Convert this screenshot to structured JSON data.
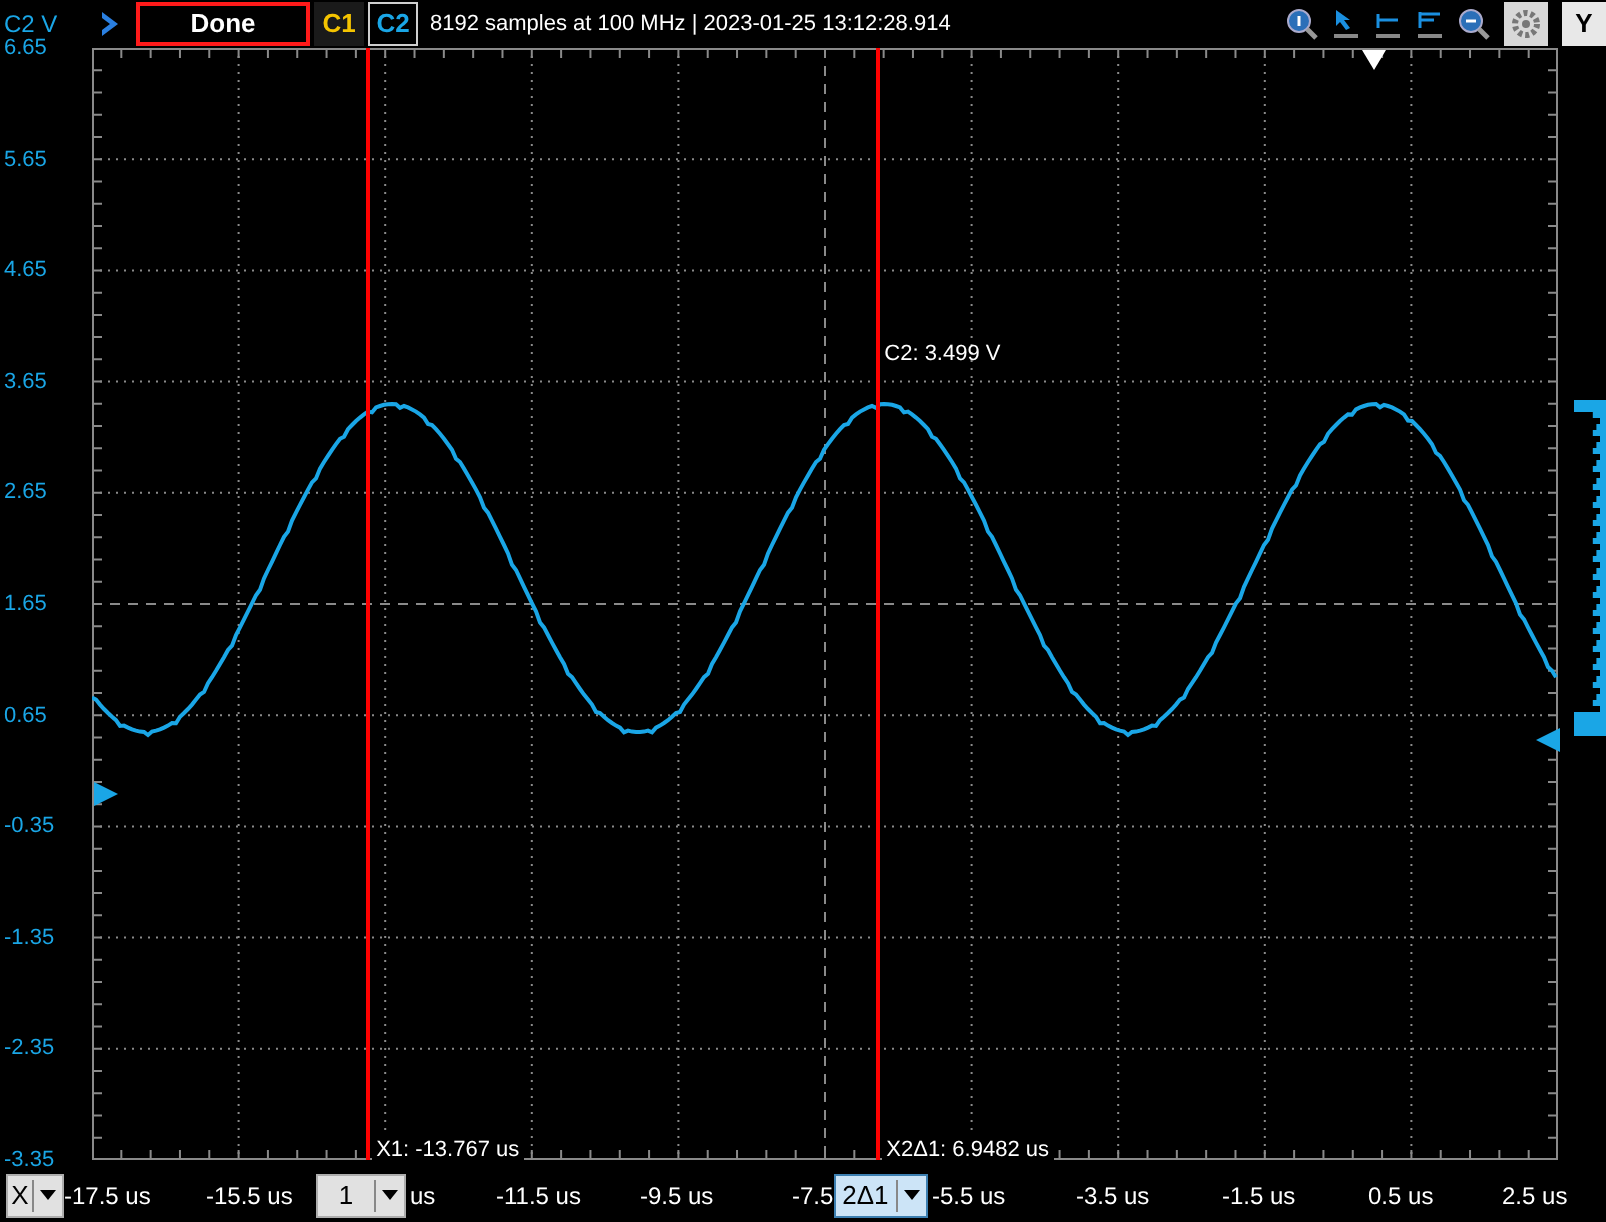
{
  "top_bar": {
    "axis_label": "C2 V",
    "status": "Done",
    "channels": [
      {
        "label": "C1",
        "color": "#f5c400",
        "selected": false
      },
      {
        "label": "C2",
        "color": "#1aa6e6",
        "selected": true
      }
    ],
    "info": "8192 samples at 100 MHz | 2023-01-25 13:12:28.914",
    "y_button": "Y"
  },
  "y_axis": {
    "labels": [
      "6.65",
      "5.65",
      "4.65",
      "3.65",
      "2.65",
      "1.65",
      "0.65",
      "-0.35",
      "-1.35",
      "-2.35",
      "-3.35"
    ]
  },
  "readout": "C2: 3.499 V",
  "cursors": [
    {
      "label": "X1: -13.767 us",
      "level": 0.187
    },
    {
      "label": "X2Δ1: 6.9482 us",
      "level": 0.535
    }
  ],
  "x_axis": {
    "items": [
      {
        "kind": "dropdown",
        "text": "X"
      },
      {
        "kind": "label",
        "text": "-17.5 us"
      },
      {
        "kind": "label",
        "text": "-15.5 us"
      },
      {
        "kind": "unit-dropdown",
        "text": "1",
        "unit": "us"
      },
      {
        "kind": "label",
        "text": "-11.5 us"
      },
      {
        "kind": "label",
        "text": "-9.5 us"
      },
      {
        "kind": "cut-dropdown",
        "text": "-7.5",
        "value": "2Δ1"
      },
      {
        "kind": "label",
        "text": "-5.5 us"
      },
      {
        "kind": "label",
        "text": "-3.5 us"
      },
      {
        "kind": "label",
        "text": "-1.5 us"
      },
      {
        "kind": "label",
        "text": "0.5 us"
      },
      {
        "kind": "label",
        "text": "2.5 us"
      }
    ]
  }
}
